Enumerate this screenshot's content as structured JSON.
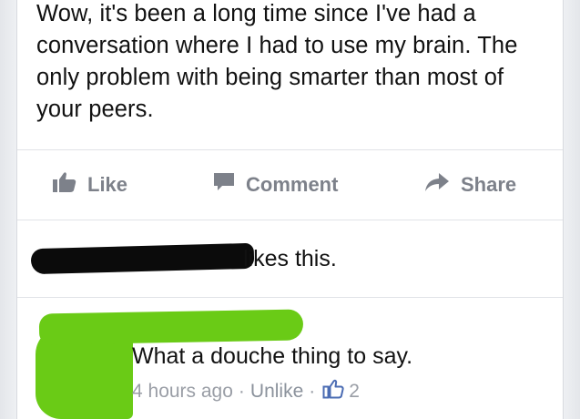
{
  "post": {
    "body": "Wow, it's been a long time since I've had a conversation where I had to use my brain. The only problem with being smarter than most of your peers."
  },
  "actions": {
    "like_label": "Like",
    "comment_label": "Comment",
    "share_label": "Share"
  },
  "likes": {
    "text": "likes this."
  },
  "comment": {
    "text": "What a douche thing to say.",
    "time": "4 hours ago",
    "separator": "·",
    "unlike_label": "Unlike",
    "like_count": "2"
  },
  "colors": {
    "action_gray": "#7d818a",
    "meta_gray": "#9a9ea6",
    "redaction_green": "#6acb16",
    "like_blue": "#4b6cb3"
  },
  "icons": {
    "like": "thumbs-up-icon",
    "comment": "speech-bubble-icon",
    "share": "share-arrow-icon",
    "comment_like": "thumbs-up-outline-icon"
  }
}
